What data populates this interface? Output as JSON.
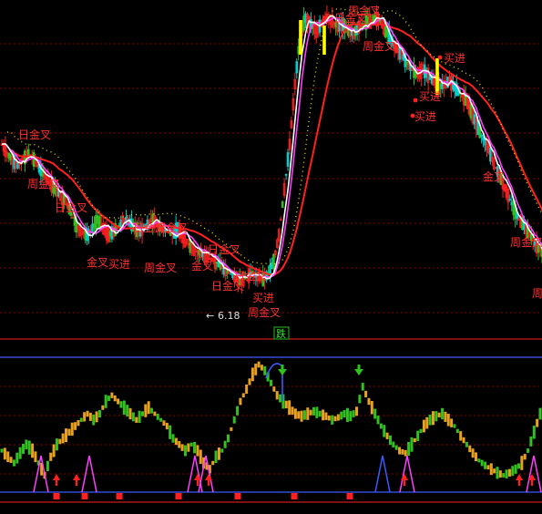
{
  "colors": {
    "background": "#000000",
    "gridline": "#8b0000",
    "panel_border": "#ff2020",
    "blue_line": "#3a5bff",
    "up_bar": "#ff2020",
    "down_bar": "#00d0d0",
    "slow_ma": "#ff2020",
    "fast_ma": "#ffffff",
    "mid_ma": "#ff40ff",
    "dotted_ma": "#e0e000",
    "green_bar": "#30c020",
    "orange_bar": "#e8a020",
    "pink_bar": "#ff40ff",
    "buy_marker": "#ffff00",
    "low_marker": "#e0e0e0",
    "fall_badge": "#20c020"
  },
  "chart_data": [
    {
      "type": "candlestick",
      "panel": "price",
      "price_labels": {
        "low_point": "6.18",
        "low_arrow": "←"
      },
      "signal_labels": [
        {
          "text": "日金叉",
          "kind": "daily_golden_cross"
        },
        {
          "text": "日金叉",
          "kind": "daily_golden_cross"
        },
        {
          "text": "周金叉",
          "kind": "weekly_golden_cross"
        },
        {
          "text": "金叉",
          "kind": "golden_cross"
        },
        {
          "text": "日金叉",
          "kind": "daily_golden_cross"
        },
        {
          "text": "周金叉",
          "kind": "weekly_golden_cross"
        },
        {
          "text": "日金叉",
          "kind": "daily_golden_cross"
        },
        {
          "text": "日金叉",
          "kind": "daily_golden_cross"
        },
        {
          "text": "买进",
          "kind": "buy"
        },
        {
          "text": "周金叉",
          "kind": "weekly_golden_cross"
        },
        {
          "text": "买进",
          "kind": "buy"
        },
        {
          "text": "日金叉",
          "kind": "daily_golden_cross"
        },
        {
          "text": "周金叉",
          "kind": "weekly_golden_cross"
        },
        {
          "text": "买进",
          "kind": "buy"
        },
        {
          "text": "周金叉",
          "kind": "weekly_golden_cross"
        },
        {
          "text": "周金叉",
          "kind": "weekly_golden_cross"
        },
        {
          "text": "日金叉",
          "kind": "daily_golden_cross"
        },
        {
          "text": "金叉",
          "kind": "golden_cross"
        },
        {
          "text": "买进",
          "kind": "buy"
        },
        {
          "text": "买进",
          "kind": "buy"
        },
        {
          "text": "金叉",
          "kind": "golden_cross"
        },
        {
          "text": "周金叉",
          "kind": "weekly_golden_cross"
        },
        {
          "text": "周",
          "kind": "weekly"
        }
      ],
      "price_path": [
        0.55,
        0.52,
        0.5,
        0.48,
        0.5,
        0.52,
        0.5,
        0.47,
        0.45,
        0.42,
        0.4,
        0.38,
        0.36,
        0.32,
        0.28,
        0.26,
        0.25,
        0.27,
        0.3,
        0.27,
        0.25,
        0.26,
        0.28,
        0.3,
        0.29,
        0.27,
        0.26,
        0.28,
        0.3,
        0.29,
        0.27,
        0.26,
        0.25,
        0.27,
        0.24,
        0.22,
        0.2,
        0.19,
        0.18,
        0.17,
        0.16,
        0.15,
        0.13,
        0.12,
        0.1,
        0.1,
        0.11,
        0.12,
        0.11,
        0.1,
        0.12,
        0.16,
        0.25,
        0.4,
        0.55,
        0.75,
        0.92,
        0.97,
        0.95,
        0.93,
        0.95,
        0.97,
        0.96,
        0.94,
        0.95,
        0.93,
        0.92,
        0.94,
        0.95,
        0.96,
        0.97,
        0.96,
        0.93,
        0.9,
        0.87,
        0.85,
        0.82,
        0.8,
        0.78,
        0.8,
        0.78,
        0.76,
        0.74,
        0.75,
        0.76,
        0.74,
        0.72,
        0.7,
        0.66,
        0.62,
        0.58,
        0.55,
        0.5,
        0.46,
        0.42,
        0.38,
        0.34,
        0.3,
        0.28,
        0.25,
        0.22,
        0.2
      ]
    },
    {
      "type": "bar",
      "panel": "indicator",
      "badge": "跌",
      "indicator_path": [
        0.3,
        0.25,
        0.2,
        0.28,
        0.35,
        0.3,
        0.2,
        0.1,
        0.25,
        0.35,
        0.4,
        0.45,
        0.5,
        0.55,
        0.6,
        0.55,
        0.6,
        0.7,
        0.75,
        0.7,
        0.65,
        0.6,
        0.55,
        0.6,
        0.65,
        0.6,
        0.55,
        0.5,
        0.4,
        0.35,
        0.3,
        0.35,
        0.3,
        0.2,
        0.15,
        0.25,
        0.3,
        0.4,
        0.55,
        0.7,
        0.8,
        0.92,
        1.0,
        0.95,
        0.85,
        0.75,
        0.7,
        0.65,
        0.6,
        0.58,
        0.6,
        0.62,
        0.6,
        0.58,
        0.55,
        0.57,
        0.6,
        0.58,
        0.62,
        0.82,
        0.7,
        0.6,
        0.5,
        0.42,
        0.35,
        0.3,
        0.28,
        0.35,
        0.42,
        0.5,
        0.55,
        0.58,
        0.6,
        0.55,
        0.5,
        0.42,
        0.35,
        0.28,
        0.22,
        0.18,
        0.15,
        0.12,
        0.1,
        0.12,
        0.15,
        0.2,
        0.3,
        0.45,
        0.6
      ]
    }
  ]
}
